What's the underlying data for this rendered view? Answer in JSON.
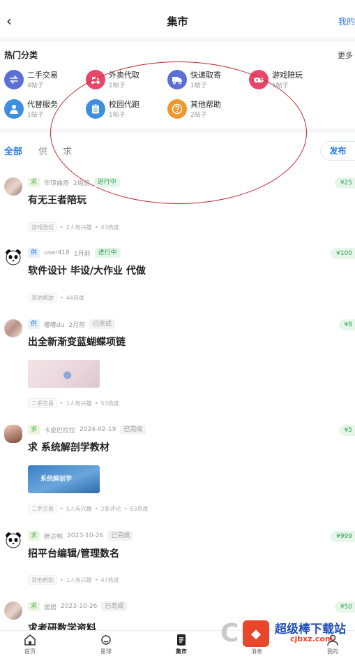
{
  "header": {
    "back_glyph": "‹",
    "title": "集市",
    "right_link": "我的"
  },
  "categories": {
    "title": "热门分类",
    "more": "更多",
    "items": [
      {
        "name": "二手交易",
        "count": "4帖子",
        "icon": "exchange-icon",
        "color": "#5b6fd6"
      },
      {
        "name": "外卖代取",
        "count": "1帖子",
        "icon": "delivery-scooter-icon",
        "color": "#e8476a"
      },
      {
        "name": "快递取寄",
        "count": "1帖子",
        "icon": "truck-icon",
        "color": "#5b6fd6"
      },
      {
        "name": "游戏陪玩",
        "count": "1帖子",
        "icon": "gamepad-icon",
        "color": "#e8476a"
      },
      {
        "name": "代替服务",
        "count": "1帖子",
        "icon": "person-icon",
        "color": "#3e8fe0"
      },
      {
        "name": "校园代跑",
        "count": "1帖子",
        "icon": "clipboard-icon",
        "color": "#3e8fe0"
      },
      {
        "name": "其他帮助",
        "count": "2帖子",
        "icon": "question-icon",
        "color": "#f0962e"
      }
    ]
  },
  "tabs": [
    {
      "label": "全部",
      "active": true
    },
    {
      "label": "供",
      "active": false
    },
    {
      "label": "求",
      "active": false
    }
  ],
  "publish_label": "发布",
  "posts": [
    {
      "type": "求",
      "author": "毕琼曲奇",
      "time": "2周前",
      "status": "进行中",
      "price": "¥25",
      "title": "有无王者陪玩",
      "category": "游戏陪玩",
      "stats": [
        "2人有兴趣",
        "43热度"
      ],
      "avatar": "user-photo-avatar"
    },
    {
      "type": "供",
      "author": "user418",
      "time": "1月前",
      "status": "进行中",
      "price": "¥100",
      "title": "软件设计 毕设/大作业 代做",
      "category": "其他帮助",
      "stats": [
        "44热度"
      ],
      "avatar": "panda-avatar"
    },
    {
      "type": "供",
      "author": "嘟嘟du",
      "time": "2月前",
      "status": "已完成",
      "price": "¥8",
      "title": "出全新渐变蓝蝴蝶项链",
      "category": "二手交易",
      "stats": [
        "1人有兴趣",
        "53热度"
      ],
      "avatar": "user-photo-avatar",
      "image": "necklace-photo"
    },
    {
      "type": "求",
      "author": "卡皮巴拉拉",
      "time": "2024-02-19",
      "status": "已完成",
      "price": "¥5",
      "title": "求 系统解剖学教材",
      "category": "二手交易",
      "stats": [
        "5人有兴趣",
        "2条评论",
        "83热度"
      ],
      "avatar": "cartoon-avatar",
      "image": "textbook-photo",
      "image_text": "系统解剖学"
    },
    {
      "type": "求",
      "author": "胖达鸭",
      "time": "2023-10-26",
      "status": "已完成",
      "price": "¥999",
      "title": "招平台编辑/管理数名",
      "category": "其他帮助",
      "stats": [
        "1人有兴趣",
        "47热度"
      ],
      "avatar": "panda-avatar"
    },
    {
      "type": "求",
      "author": "居居",
      "time": "2023-10-26",
      "status": "已完成",
      "price": "¥50",
      "title": "求考研数学资料",
      "avatar": "user-photo-avatar"
    }
  ],
  "bottom_nav": [
    {
      "label": "首页",
      "icon": "home-icon"
    },
    {
      "label": "星球",
      "icon": "planet-icon"
    },
    {
      "label": "集市",
      "icon": "market-icon",
      "active": true
    },
    {
      "label": "消息",
      "icon": "message-icon"
    },
    {
      "label": "我的",
      "icon": "profile-icon"
    }
  ],
  "watermark": {
    "text": "超级棒下载站",
    "url": "cjbxz.com"
  }
}
